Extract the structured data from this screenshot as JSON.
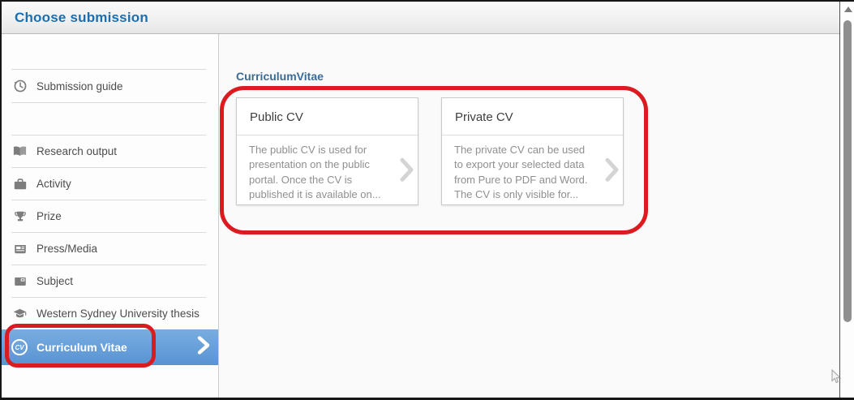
{
  "window": {
    "title": "Choose submission"
  },
  "sidebar": {
    "guide_item": {
      "label": "Submission guide",
      "icon": "history-clock-icon"
    },
    "items": [
      {
        "label": "Research output",
        "icon": "open-book-icon"
      },
      {
        "label": "Activity",
        "icon": "briefcase-icon"
      },
      {
        "label": "Prize",
        "icon": "trophy-icon"
      },
      {
        "label": "Press/Media",
        "icon": "newspaper-icon"
      },
      {
        "label": "Subject",
        "icon": "image-icon"
      },
      {
        "label": "Western Sydney University thesis",
        "icon": "graduation-cap-icon"
      }
    ],
    "selected_item": {
      "label": "Curriculum Vitae",
      "icon": "cv-badge-icon",
      "badge_text": "CV",
      "chevron": "chevron-right-icon"
    }
  },
  "content": {
    "section_title": "CurriculumVitae",
    "cards": [
      {
        "title": "Public CV",
        "description": "The public CV is used for presentation on the public portal. Once the CV is published it is available on...",
        "chevron": "chevron-right-icon"
      },
      {
        "title": "Private CV",
        "description": "The private CV can be used to export your selected data from Pure to PDF and Word. The CV is only visible for...",
        "chevron": "chevron-right-icon"
      }
    ]
  },
  "annotations": {
    "shape": "red-highlight",
    "color": "#dc1b21"
  },
  "colors": {
    "title_blue": "#1b6fb0",
    "section_title_blue": "#3a6b96",
    "selection_blue_top": "#79ade0",
    "selection_blue_bottom": "#5893d3",
    "annotation_red": "#dc1b21"
  }
}
